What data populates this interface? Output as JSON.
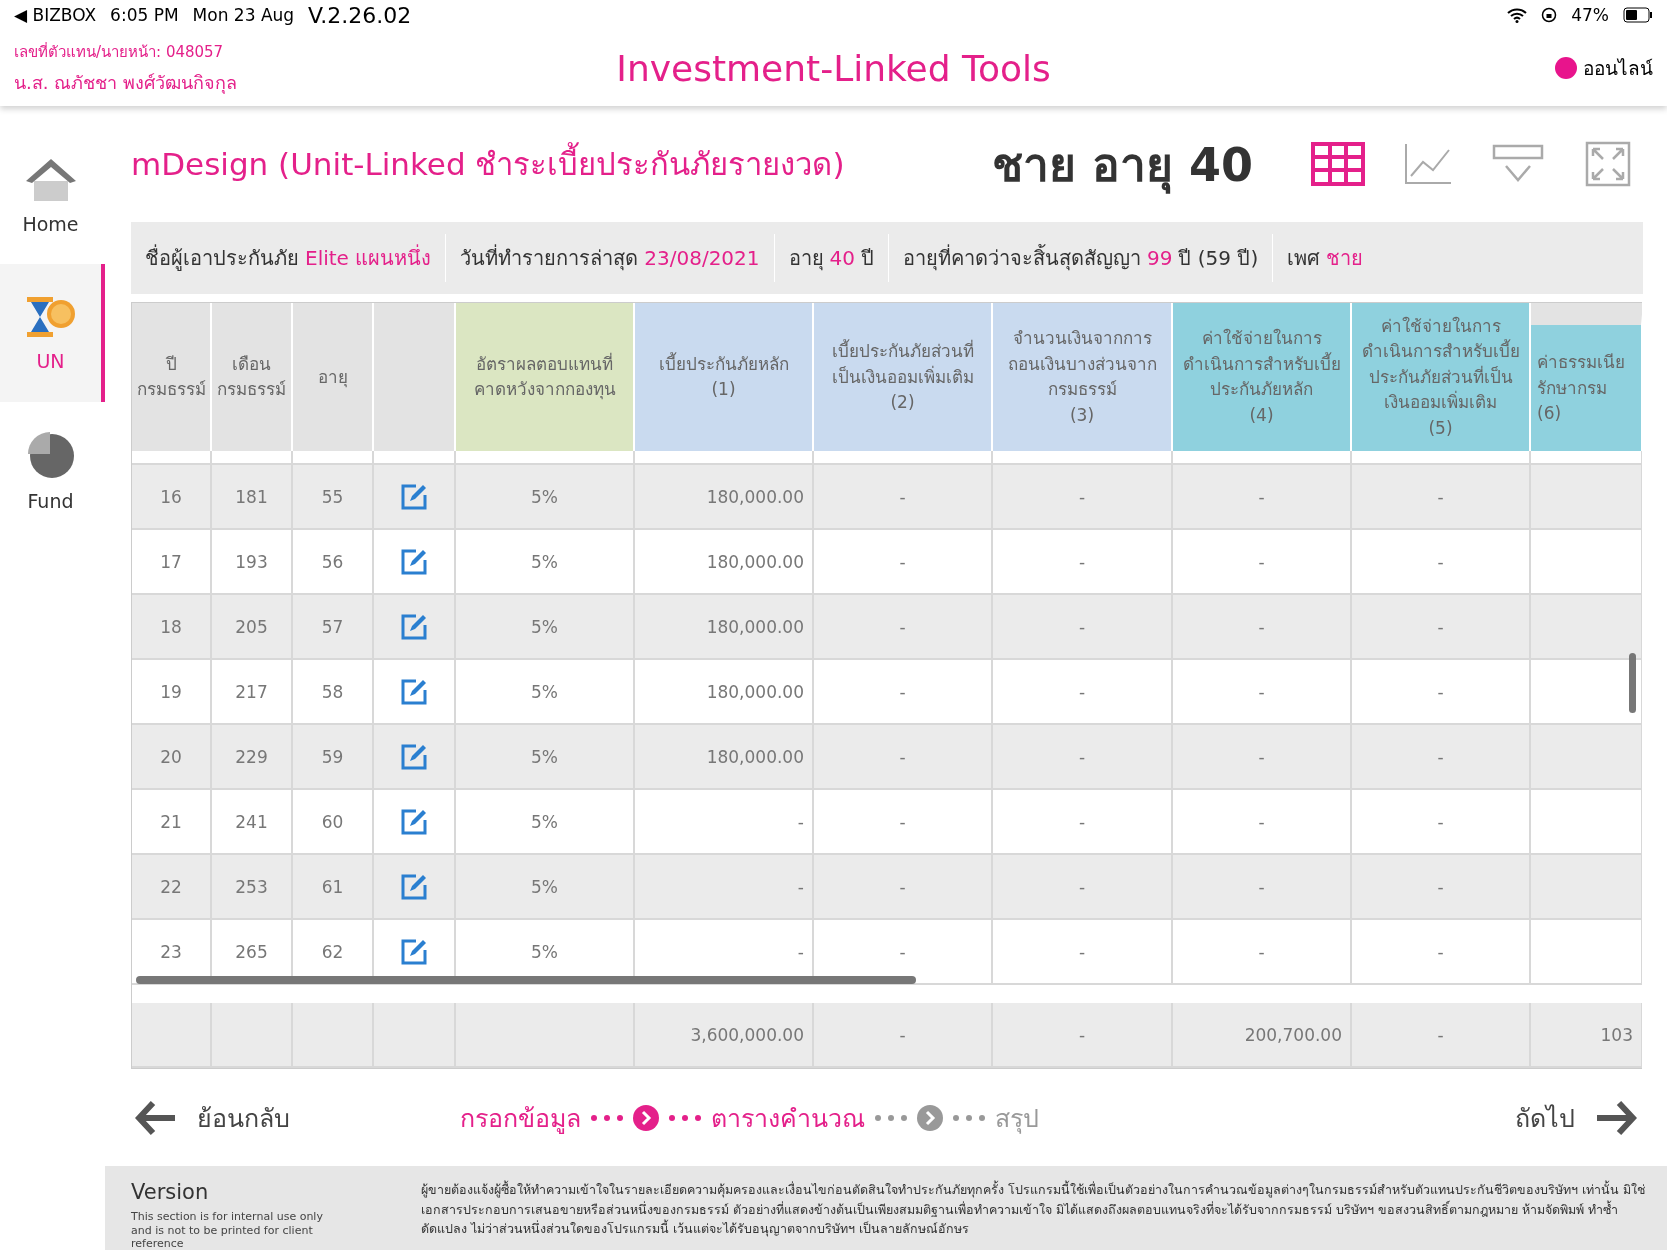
{
  "status_bar": {
    "back_app": "◀ BIZBOX",
    "time": "6:05 PM",
    "date": "Mon 23 Aug",
    "version": "V.2.26.02",
    "battery": "47%"
  },
  "header": {
    "agent_id": "เลขที่ตัวแทน/นายหน้า: 048057",
    "agent_name": "น.ส. ณภัชชา  พงศ์วัฒนกิจกุล",
    "title": "Investment-Linked Tools",
    "status": {
      "label": "ออนไลน์",
      "color": "#e8148c"
    }
  },
  "sidebar": {
    "items": [
      {
        "kind": "home",
        "label": "Home",
        "selected": false
      },
      {
        "kind": "unit",
        "label": "UN",
        "selected": true
      },
      {
        "kind": "fund",
        "label": "Fund",
        "selected": false
      }
    ]
  },
  "page_title": "mDesign (Unit-Linked ชำระเบี้ยประกันภัยรายงวด)",
  "subject": "ชาย อายุ 40",
  "view_tools": [
    {
      "kind": "table",
      "selected": true
    },
    {
      "kind": "chart",
      "selected": false
    },
    {
      "kind": "filter",
      "selected": false
    },
    {
      "kind": "fullscreen",
      "selected": false
    }
  ],
  "info_bar": [
    {
      "label": "ชื่อผู้เอาประกันภัย",
      "value": "Elite แผนหนึ่ง"
    },
    {
      "label": "วันที่ทำรายการล่าสุด",
      "value": "23/08/2021"
    },
    {
      "label": "อายุ",
      "value": "40",
      "suffix": "ปี"
    },
    {
      "label": "อายุที่คาดว่าจะสิ้นสุดสัญญา",
      "value": "99",
      "suffix": "ปี (59 ปี)"
    },
    {
      "label": "เพศ",
      "value": "ชาย"
    }
  ],
  "table": {
    "columns": [
      {
        "kind": "grey",
        "lines": [
          "ปี",
          "กรมธรรม์"
        ]
      },
      {
        "kind": "grey",
        "lines": [
          "เดือน",
          "กรมธรรม์"
        ]
      },
      {
        "kind": "grey",
        "lines": [
          "อายุ"
        ]
      },
      {
        "kind": "grey"
      },
      {
        "kind": "green",
        "lines": [
          "อัตราผลตอบแทนที่",
          "คาดหวังจากกองทุน"
        ]
      },
      {
        "kind": "blue",
        "lines": [
          "เบี้ยประกันภัยหลัก",
          "(1)"
        ]
      },
      {
        "kind": "blue",
        "lines": [
          "เบี้ยประกันภัยส่วนที่",
          "เป็นเงินออมเพิ่มเติม",
          "(2)"
        ]
      },
      {
        "kind": "blue",
        "lines": [
          "จำนวนเงินจากการ",
          "ถอนเงินบางส่วนจาก",
          "กรมธรรม์",
          "(3)"
        ]
      },
      {
        "kind": "teal",
        "lines": [
          "ค่าใช้จ่ายในการ",
          "ดำเนินการสำหรับเบี้ย",
          "ประกันภัยหลัก",
          "(4)"
        ]
      },
      {
        "kind": "teal",
        "lines": [
          "ค่าใช้จ่ายในการ",
          "ดำเนินการสำหรับเบี้ย",
          "ประกันภัยส่วนที่เป็น",
          "เงินออมเพิ่มเติม",
          "(5)"
        ]
      },
      {
        "kind": "cut",
        "lines": [
          "ค่าธรรมเนีย",
          "รักษากรม",
          "(6)"
        ]
      }
    ],
    "rows": [
      {
        "year": "16",
        "month": "181",
        "age": "55",
        "rate": "5%",
        "values": [
          "180,000.00",
          "-",
          "-",
          "-",
          "-"
        ]
      },
      {
        "year": "17",
        "month": "193",
        "age": "56",
        "rate": "5%",
        "values": [
          "180,000.00",
          "-",
          "-",
          "-",
          "-"
        ]
      },
      {
        "year": "18",
        "month": "205",
        "age": "57",
        "rate": "5%",
        "values": [
          "180,000.00",
          "-",
          "-",
          "-",
          "-"
        ]
      },
      {
        "year": "19",
        "month": "217",
        "age": "58",
        "rate": "5%",
        "values": [
          "180,000.00",
          "-",
          "-",
          "-",
          "-"
        ]
      },
      {
        "year": "20",
        "month": "229",
        "age": "59",
        "rate": "5%",
        "values": [
          "180,000.00",
          "-",
          "-",
          "-",
          "-"
        ]
      },
      {
        "year": "21",
        "month": "241",
        "age": "60",
        "rate": "5%",
        "values": [
          "-",
          "-",
          "-",
          "-",
          "-"
        ]
      },
      {
        "year": "22",
        "month": "253",
        "age": "61",
        "rate": "5%",
        "values": [
          "-",
          "-",
          "-",
          "-",
          "-"
        ]
      },
      {
        "year": "23",
        "month": "265",
        "age": "62",
        "rate": "5%",
        "values": [
          "-",
          "-",
          "-",
          "-",
          "-"
        ]
      }
    ],
    "totals": [
      "3,600,000.00",
      "-",
      "-",
      "200,700.00",
      "-",
      "103"
    ]
  },
  "nav": {
    "back": "ย้อนกลับ",
    "next": "ถัดไป",
    "steps": [
      {
        "label": "กรอกข้อมูล",
        "active": true
      },
      {
        "label": "ตารางคำนวณ",
        "active": true
      },
      {
        "label": "สรุป",
        "active": false
      }
    ]
  },
  "footer": {
    "version_title": "Version",
    "version_note": "This section is for internal use only and is not to be printed for client reference",
    "disclaimer": "ผู้ขายต้องแจ้งผู้ซื้อให้ทำความเข้าใจในรายละเอียดความคุ้มครองและเงื่อนไขก่อนตัดสินใจทำประกันภัยทุกครั้ง โปรแกรมนี้ใช้เพื่อเป็นตัวอย่างในการคำนวณข้อมูลต่างๆในกรมธรรม์สำหรับตัวแทนประกันชีวิตของบริษัทฯ เท่านั้น มิใช่เอกสารประกอบการเสนอขายหรือส่วนหนึ่งของกรมธรรม์ ตัวอย่างที่แสดงข้างต้นเป็นเพียงสมมติฐานเพื่อทำความเข้าใจ มิได้แสดงถึงผลตอบแทนจริงที่จะได้รับจากกรมธรรม์ บริษัทฯ ขอสงวนสิทธิ์ตามกฎหมาย ห้ามจัดพิมพ์ ทำซ้ำ ดัดแปลง ไม่ว่าส่วนหนึ่งส่วนใดของโปรแกรมนี้ เว้นแต่จะได้รับอนุญาตจากบริษัทฯ เป็นลายลักษณ์อักษร"
  }
}
